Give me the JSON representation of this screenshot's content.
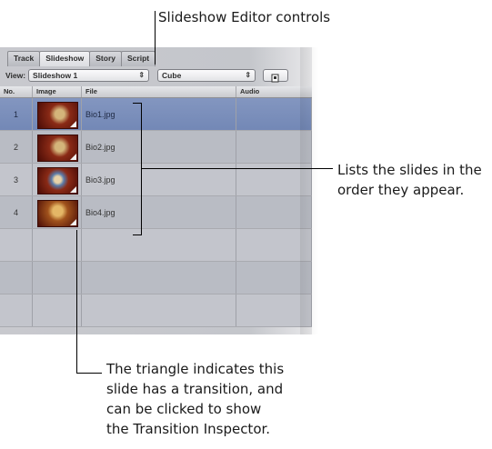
{
  "callouts": {
    "top": "Slideshow Editor controls",
    "right_line1": "Lists the slides in the",
    "right_line2": "order they appear.",
    "bottom_line1": "The triangle indicates this",
    "bottom_line2": "slide has a transition, and",
    "bottom_line3": "can be clicked to show",
    "bottom_line4": "the Transition Inspector."
  },
  "tabs": [
    "Track",
    "Slideshow",
    "Story",
    "Script"
  ],
  "active_tab": "Slideshow",
  "viewbar": {
    "label": "View:",
    "view_value": "Slideshow 1",
    "transition_value": "Cube",
    "popup_arrows": "⇕"
  },
  "table": {
    "headers": [
      "No.",
      "Image",
      "File",
      "Audio"
    ],
    "rows": [
      {
        "no": "1",
        "file": "Bio1.jpg",
        "audio": "",
        "selected": true
      },
      {
        "no": "2",
        "file": "Bio2.jpg",
        "audio": "",
        "selected": false
      },
      {
        "no": "3",
        "file": "Bio3.jpg",
        "audio": "",
        "selected": false
      },
      {
        "no": "4",
        "file": "Bio4.jpg",
        "audio": "",
        "selected": false
      }
    ]
  },
  "colors": {
    "selected_row": "#7b8fbb",
    "panel_bg": "#c4c6cb"
  }
}
